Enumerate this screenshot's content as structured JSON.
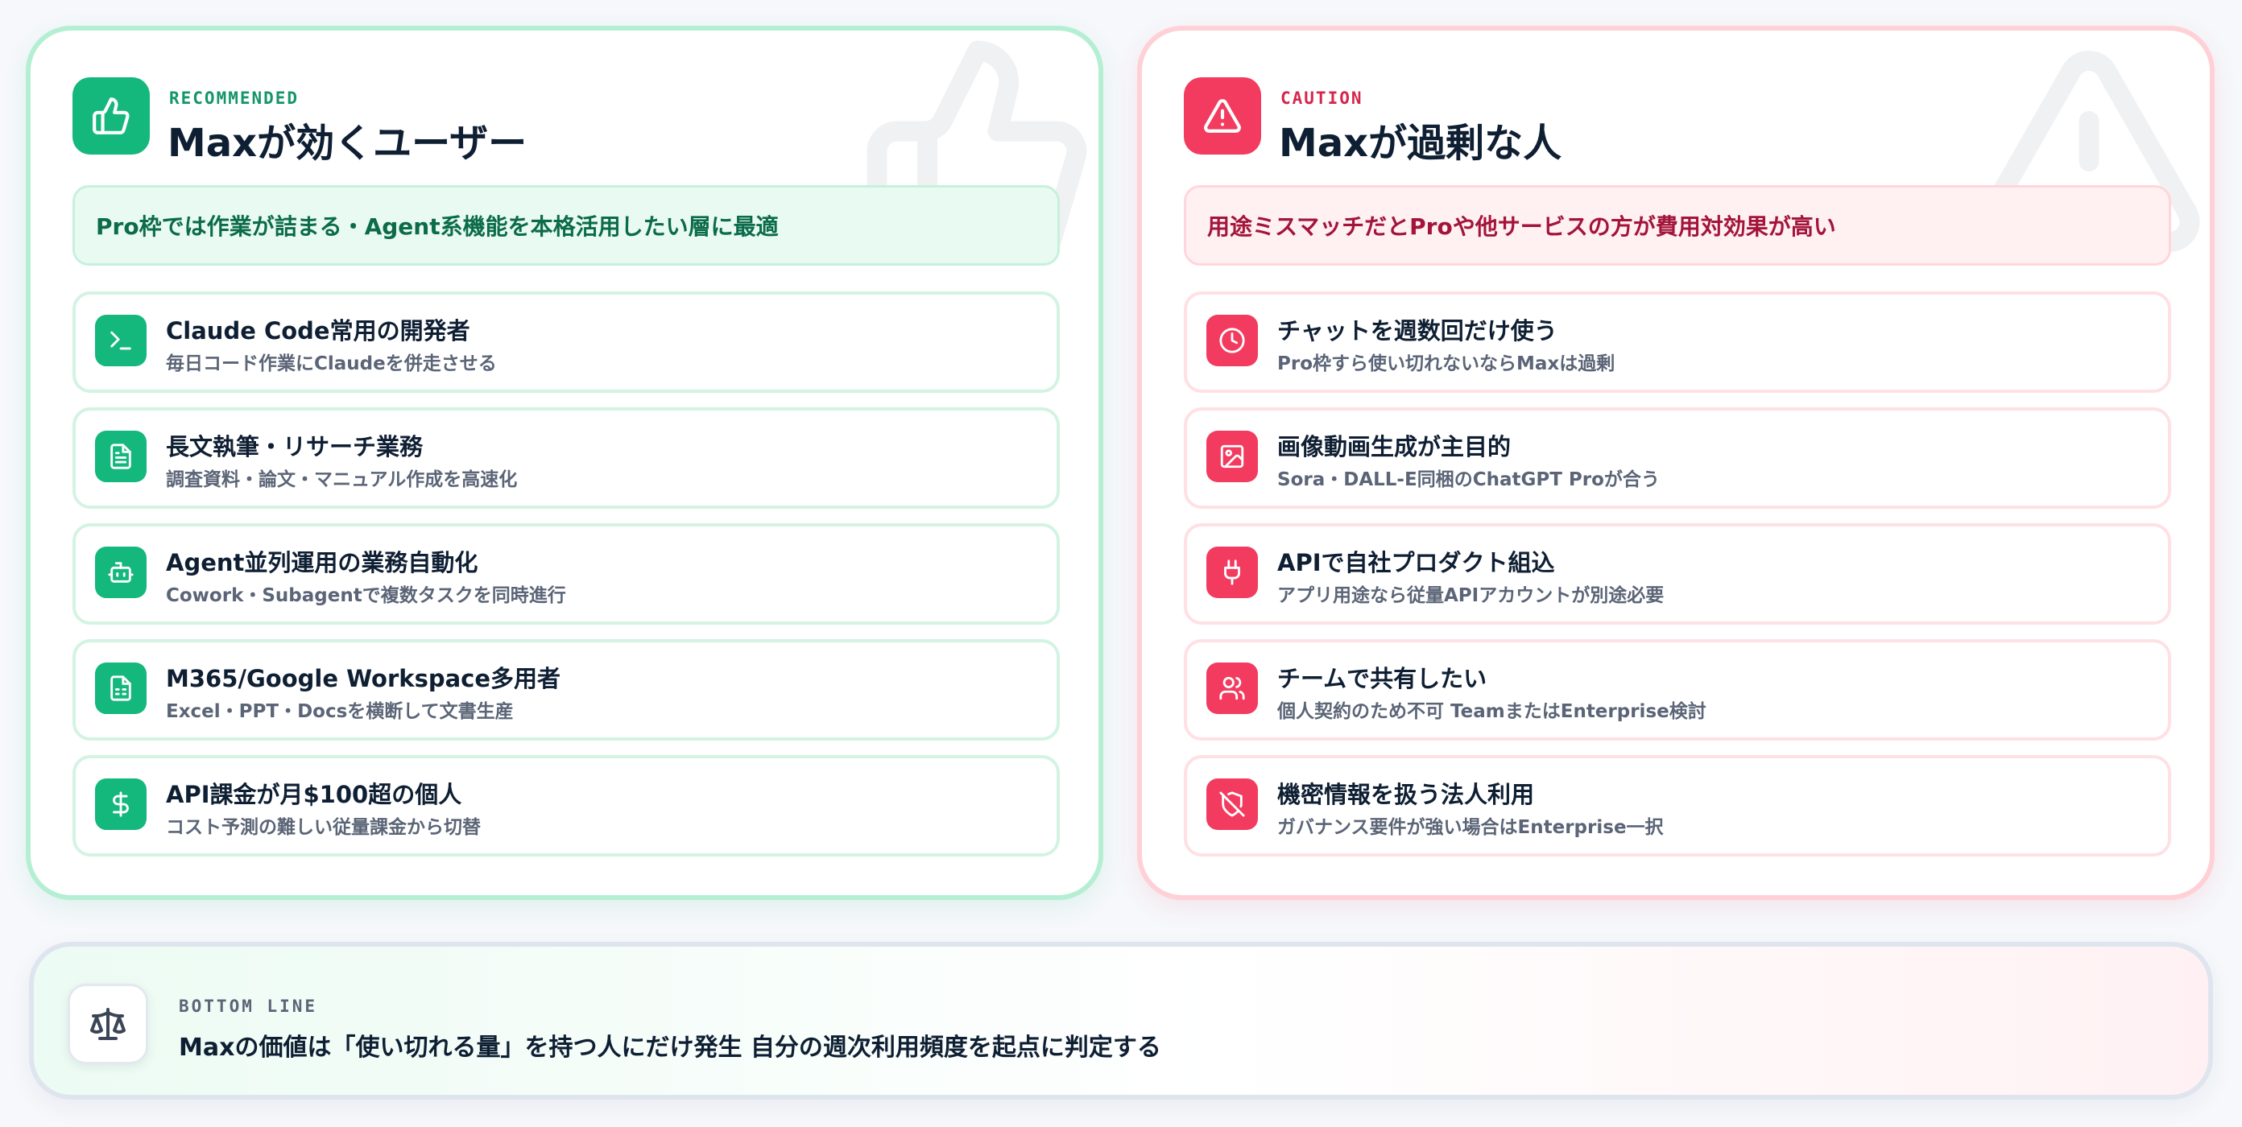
{
  "recommended": {
    "eyebrow": "RECOMMENDED",
    "title": "Maxが効くユーザー",
    "summary": "Pro枠では作業が詰まる・Agent系機能を本格活用したい層に最適",
    "badge_icon": "thumbs-up-icon",
    "accent": "#14b87c",
    "items": [
      {
        "icon": "terminal-icon",
        "title": "Claude Code常用の開発者",
        "desc": "毎日コード作業にClaudeを併走させる"
      },
      {
        "icon": "document-icon",
        "title": "長文執筆・リサーチ業務",
        "desc": "調査資料・論文・マニュアル作成を高速化"
      },
      {
        "icon": "robot-icon",
        "title": "Agent並列運用の業務自動化",
        "desc": "Cowork・Subagentで複数タスクを同時進行"
      },
      {
        "icon": "spreadsheet-icon",
        "title": "M365/Google Workspace多用者",
        "desc": "Excel・PPT・Docsを横断して文書生産"
      },
      {
        "icon": "dollar-icon",
        "title": "API課金が月$100超の個人",
        "desc": "コスト予測の難しい従量課金から切替"
      }
    ]
  },
  "caution": {
    "eyebrow": "CAUTION",
    "title": "Maxが過剰な人",
    "summary": "用途ミスマッチだとProや他サービスの方が費用対効果が高い",
    "badge_icon": "warning-icon",
    "accent": "#f23b5f",
    "items": [
      {
        "icon": "clock-icon",
        "title": "チャットを週数回だけ使う",
        "desc": "Pro枠すら使い切れないならMaxは過剰"
      },
      {
        "icon": "image-icon",
        "title": "画像動画生成が主目的",
        "desc": "Sora・DALL-E同梱のChatGPT Proが合う"
      },
      {
        "icon": "plug-icon",
        "title": "APIで自社プロダクト組込",
        "desc": "アプリ用途なら従量APIアカウントが別途必要"
      },
      {
        "icon": "users-icon",
        "title": "チームで共有したい",
        "desc": "個人契約のため不可 TeamまたはEnterprise検討"
      },
      {
        "icon": "shield-off-icon",
        "title": "機密情報を扱う法人利用",
        "desc": "ガバナンス要件が強い場合はEnterprise一択"
      }
    ]
  },
  "bottom_line": {
    "label": "BOTTOM LINE",
    "text": "Maxの価値は「使い切れる量」を持つ人にだけ発生 自分の週次利用頻度を起点に判定する",
    "icon": "scale-icon"
  }
}
